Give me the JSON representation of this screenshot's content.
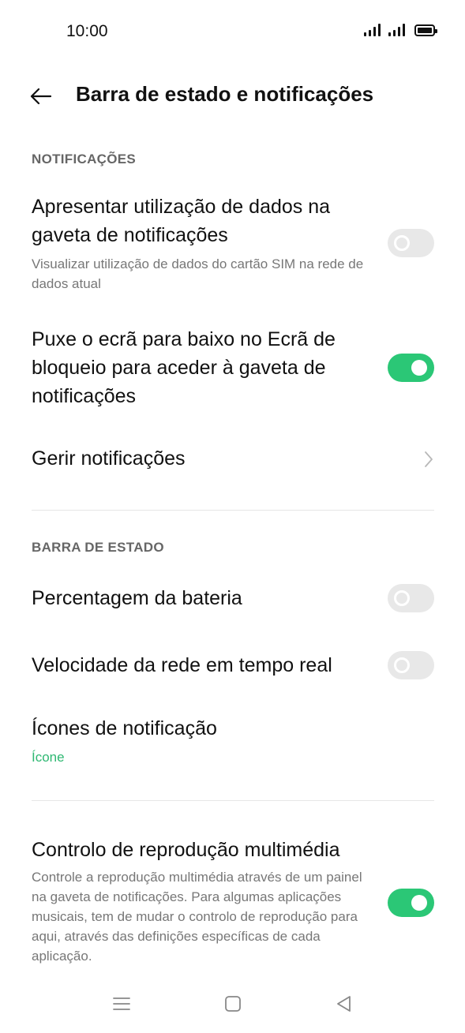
{
  "status_bar": {
    "time": "10:00"
  },
  "header": {
    "title": "Barra de estado e notificações"
  },
  "sections": {
    "notifications": {
      "header": "NOTIFICAÇÕES",
      "data_usage": {
        "title": "Apresentar utilização de dados na gaveta de notificações",
        "subtitle": "Visualizar utilização de dados do cartão SIM na rede de dados atual",
        "enabled": false
      },
      "lockscreen_pull": {
        "title": "Puxe o ecrã para baixo no Ecrã de bloqueio para aceder à gaveta de notificações",
        "enabled": true
      },
      "manage": {
        "title": "Gerir notificações"
      }
    },
    "status_bar": {
      "header": "BARRA DE ESTADO",
      "battery_percent": {
        "title": "Percentagem da bateria",
        "enabled": false
      },
      "network_speed": {
        "title": "Velocidade da rede em tempo real",
        "enabled": false
      },
      "notification_icons": {
        "title": "Ícones de notificação",
        "value": "Ícone"
      }
    },
    "media": {
      "title": "Controlo de reprodução multimédia",
      "subtitle": "Controle a reprodução multimédia através de um painel na gaveta de notificações. Para algumas aplicações musicais, tem de mudar o controlo de reprodução para aqui, através das definições específicas de cada aplicação.",
      "enabled": true
    }
  },
  "colors": {
    "accent": "#2bc776",
    "toggle_off": "#e8e8e8",
    "subtitle": "#777777"
  },
  "icons": {
    "back": "arrow-left-icon",
    "chevron": "chevron-right-icon",
    "nav_menu": "menu-icon",
    "nav_home": "square-icon",
    "nav_back": "triangle-back-icon"
  }
}
